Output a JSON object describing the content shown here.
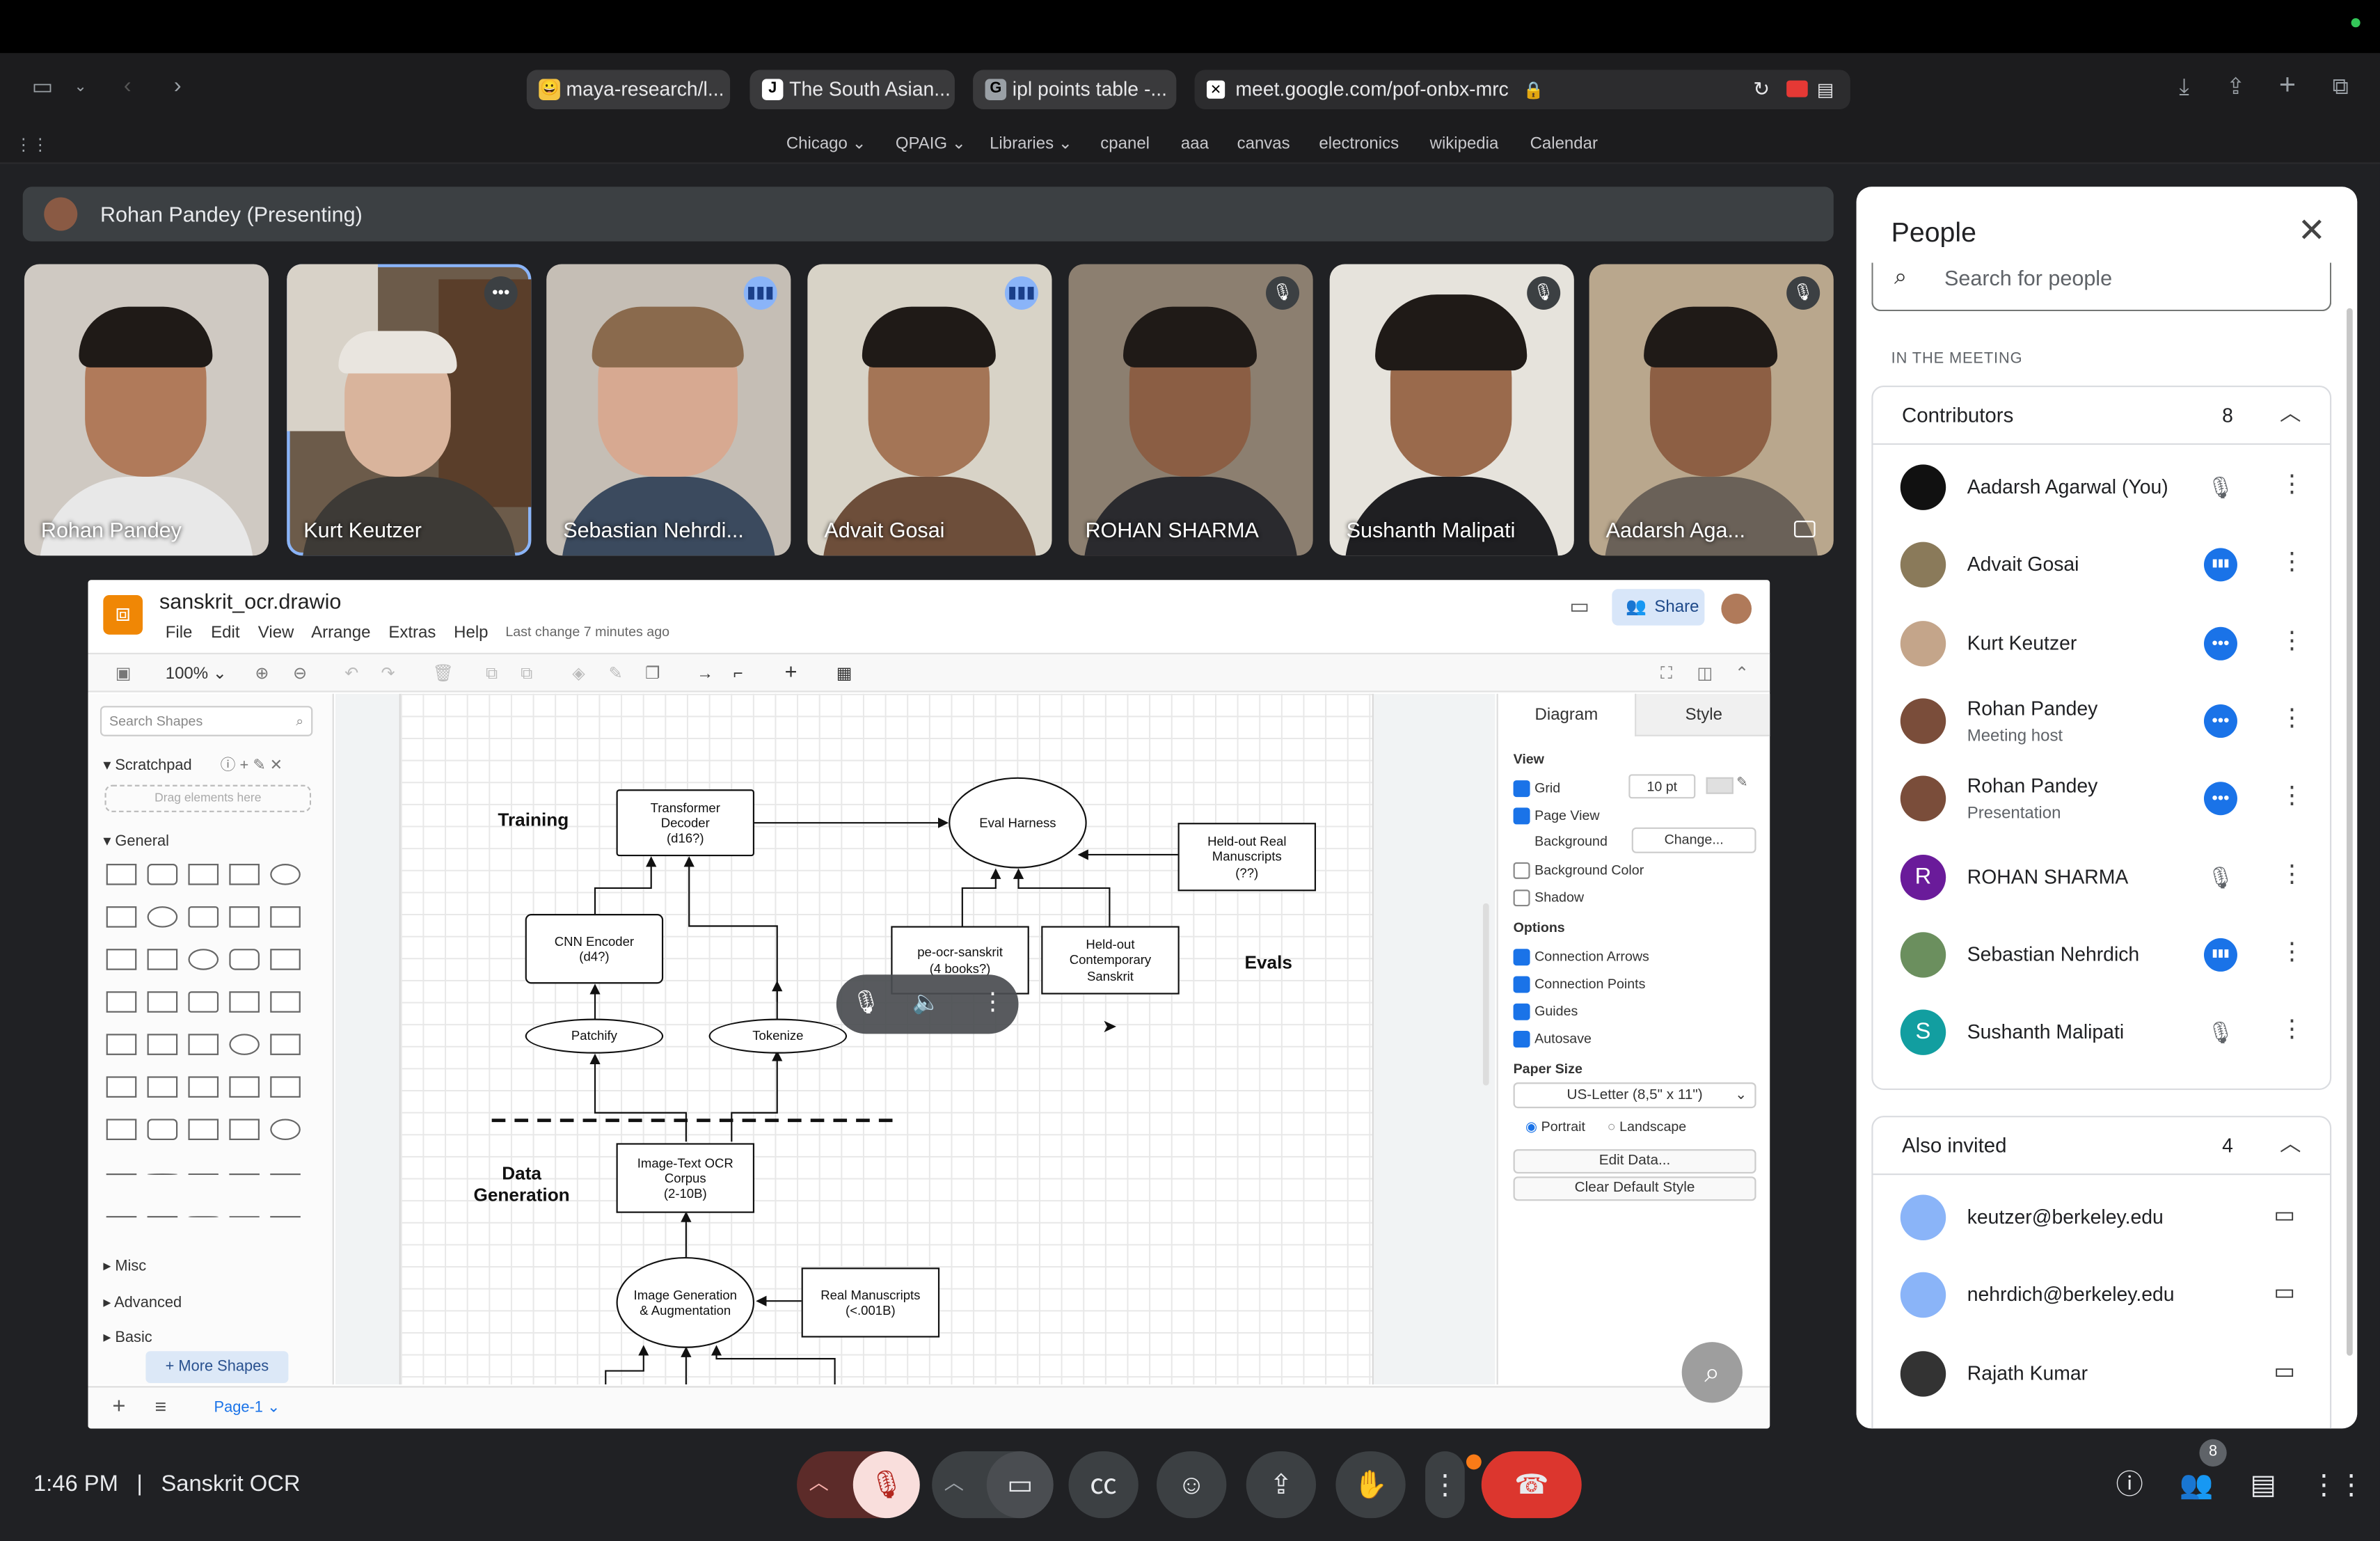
{
  "browser": {
    "tabs": [
      {
        "label": "maya-research/l...",
        "fav": "😀",
        "favbg": "#f5c542"
      },
      {
        "label": "The South Asian...",
        "fav": "J",
        "favbg": "#ffffff"
      },
      {
        "label": "ipl points table -...",
        "fav": "G",
        "favbg": "#9aa0a6"
      }
    ],
    "url": "meet.google.com/pof-onbx-mrc",
    "bookmarks": [
      "Chicago",
      "QPAIG",
      "Libraries",
      "cpanel",
      "aaa",
      "canvas",
      "electronics",
      "wikipedia",
      "Calendar"
    ]
  },
  "meet": {
    "presenting": "Rohan Pandey (Presenting)",
    "tiles": [
      {
        "name": "Rohan Pandey",
        "badge": ""
      },
      {
        "name": "Kurt Keutzer",
        "badge": "•••"
      },
      {
        "name": "Sebastian Nehrdi...",
        "badge": "▮▮▮"
      },
      {
        "name": "Advait Gosai",
        "badge": "▮▮▮"
      },
      {
        "name": "ROHAN SHARMA",
        "badge": "🎙"
      },
      {
        "name": "Sushanth Malipati",
        "badge": "🎙"
      },
      {
        "name": "Aadarsh Aga...",
        "badge": "🎙"
      }
    ],
    "time": "1:46 PM",
    "separator": "|",
    "meeting_name": "Sanskrit OCR",
    "participant_count": "8"
  },
  "drawio": {
    "filename": "sanskrit_ocr.drawio",
    "menu": [
      "File",
      "Edit",
      "View",
      "Arrange",
      "Extras",
      "Help"
    ],
    "last_change": "Last change 7 minutes ago",
    "share": "Share",
    "zoom": "100%",
    "search_placeholder": "Search Shapes",
    "scratchpad": "Scratchpad",
    "drag_hint": "Drag elements here",
    "general": "General",
    "misc": "Misc",
    "advanced": "Advanced",
    "basic": "Basic",
    "more_shapes": "+ More Shapes",
    "page_tab": "Page-1",
    "diagram": {
      "training": "Training",
      "evals": "Evals",
      "data_generation": "Data\nGeneration",
      "transformer": "Transformer\nDecoder\n(d16?)",
      "eval_harness": "Eval Harness",
      "heldout_manu": "Held-out Real\nManuscripts\n(??)",
      "cnn": "CNN Encoder\n(d4?)",
      "peocr": "pe-ocr-sanskrit\n(4 books?)",
      "heldout_contemp": "Held-out\nContemporary\nSanskrit",
      "patchify": "Patchify",
      "tokenize": "Tokenize",
      "corpus": "Image-Text OCR\nCorpus\n(2-10B)",
      "imggen": "Image Generation\n& Augmentation",
      "realmanu": "Real Manuscripts\n(<.001B)"
    },
    "panel": {
      "tab_diagram": "Diagram",
      "tab_style": "Style",
      "view": "View",
      "grid": "Grid",
      "grid_size": "10 pt",
      "page_view": "Page View",
      "background": "Background",
      "change": "Change...",
      "bg_color": "Background Color",
      "shadow": "Shadow",
      "options": "Options",
      "conn_arrows": "Connection Arrows",
      "conn_points": "Connection Points",
      "guides": "Guides",
      "autosave": "Autosave",
      "paper_size": "Paper Size",
      "paper_value": "US-Letter (8,5\" x 11\")",
      "portrait": "Portrait",
      "landscape": "Landscape",
      "edit_data": "Edit Data...",
      "clear_style": "Clear Default Style"
    }
  },
  "people": {
    "title": "People",
    "search_placeholder": "Search for people",
    "in_meeting": "IN THE MEETING",
    "contributors_label": "Contributors",
    "contributors_count": "8",
    "contributors": [
      {
        "name": "Aadarsh Agarwal (You)",
        "sub": "",
        "avatar": "",
        "color": "#111111",
        "status": "muted"
      },
      {
        "name": "Advait Gosai",
        "sub": "",
        "avatar": "",
        "color": "#8a7a5a",
        "status": "talking"
      },
      {
        "name": "Kurt Keutzer",
        "sub": "",
        "avatar": "",
        "color": "#c4a58a",
        "status": "more"
      },
      {
        "name": "Rohan Pandey",
        "sub": "Meeting host",
        "avatar": "",
        "color": "#7a4d3a",
        "status": "more"
      },
      {
        "name": "Rohan Pandey",
        "sub": "Presentation",
        "avatar": "",
        "color": "#7a4d3a",
        "status": "more"
      },
      {
        "name": "ROHAN SHARMA",
        "sub": "",
        "avatar": "R",
        "color": "#6a1b9a",
        "status": "muted"
      },
      {
        "name": "Sebastian Nehrdich",
        "sub": "",
        "avatar": "",
        "color": "#6b8f5e",
        "status": "talking"
      },
      {
        "name": "Sushanth Malipati",
        "sub": "",
        "avatar": "S",
        "color": "#129ea0",
        "status": "muted"
      }
    ],
    "also_label": "Also invited",
    "also_count": "4",
    "also": [
      {
        "name": "keutzer@berkeley.edu",
        "color": "#8ab4f8"
      },
      {
        "name": "nehrdich@berkeley.edu",
        "color": "#8ab4f8"
      },
      {
        "name": "Rajath Kumar",
        "color": "#333333"
      }
    ]
  }
}
